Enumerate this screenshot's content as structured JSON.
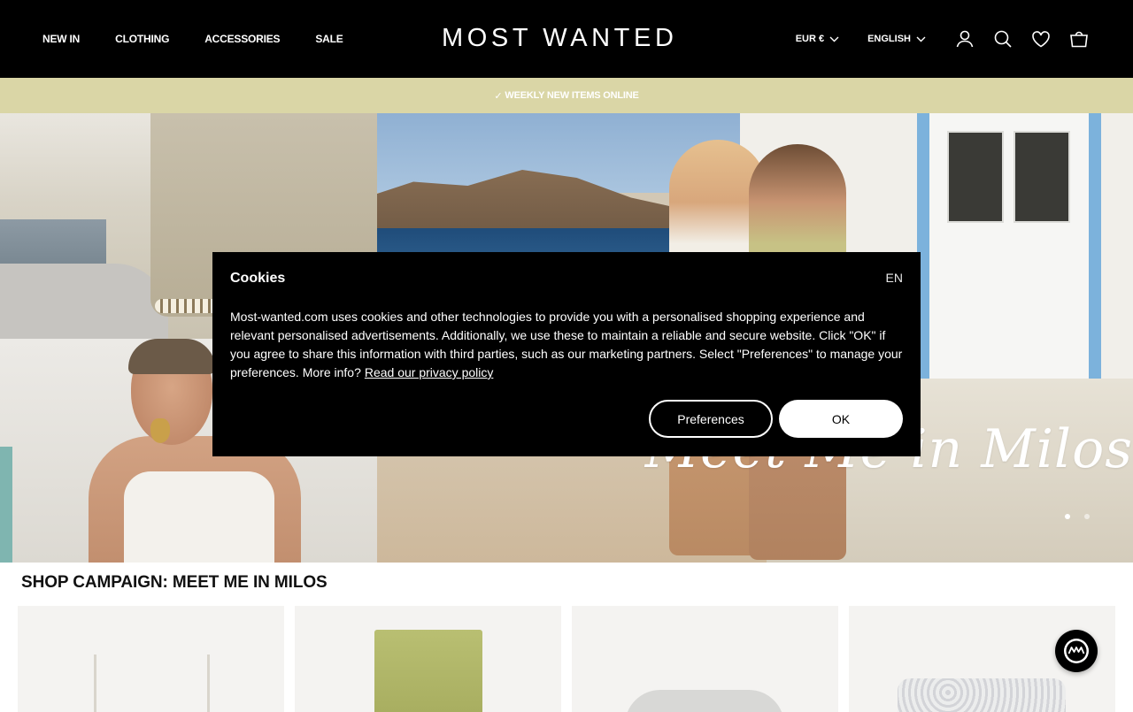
{
  "header": {
    "nav": [
      {
        "label": "NEW IN"
      },
      {
        "label": "CLOTHING"
      },
      {
        "label": "ACCESSORIES"
      },
      {
        "label": "SALE"
      }
    ],
    "logo": "MOST WANTED",
    "currency": "EUR €",
    "language": "ENGLISH",
    "icons": [
      "account-icon",
      "search-icon",
      "heart-icon",
      "cart-icon"
    ]
  },
  "announcement": {
    "check": "✓",
    "text": "WEEKLY NEW ITEMS ONLINE"
  },
  "hero": {
    "script_text": "Meet Me in Milos",
    "slides": 2,
    "active_slide": 1
  },
  "cookie": {
    "title": "Cookies",
    "lang": "EN",
    "body": "Most-wanted.com uses cookies and other technologies to provide you with a personalised shopping experience and relevant personalised advertisements. Additionally, we use these to maintain a reliable and secure website. Click \"OK\" if you agree to share this information with third parties, such as our marketing partners. Select \"Preferences\" to manage your preferences. More info?",
    "link": "Read our privacy policy",
    "preferences_label": "Preferences",
    "ok_label": "OK"
  },
  "campaign": {
    "title": "SHOP CAMPAIGN: MEET ME IN MILOS"
  },
  "colors": {
    "header_bg": "#000000",
    "announcement_bg": "#dad6a6",
    "modal_bg": "#000000"
  }
}
